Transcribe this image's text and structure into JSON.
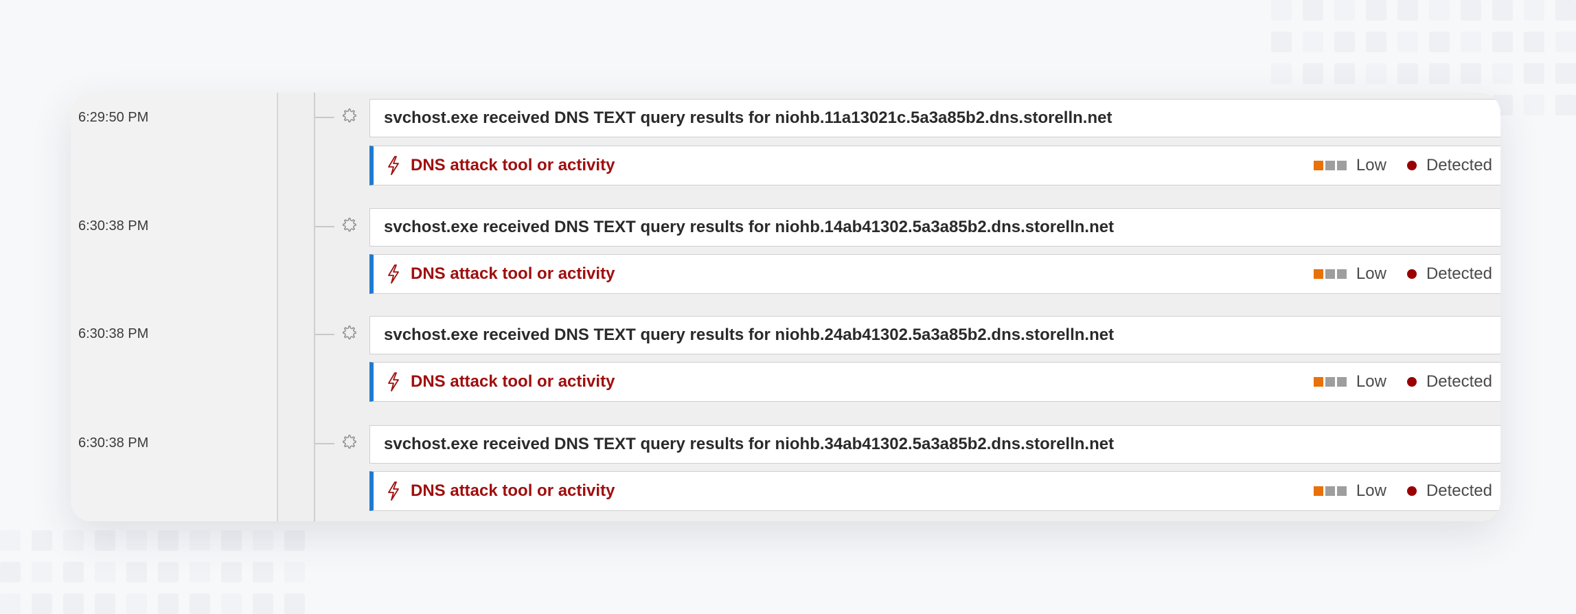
{
  "timeline": {
    "events": [
      {
        "time": "6:29:50 PM",
        "description": "svchost.exe received DNS TEXT query results for niohb.11a13021c.5a3a85b2.dns.storelln.net",
        "event_icon": "gear-icon",
        "alert": {
          "icon": "lightning-bolt-icon",
          "title": "DNS attack tool or activity",
          "severity": "Low",
          "severity_level": 1,
          "severity_max": 3,
          "status": "Detected"
        }
      },
      {
        "time": "6:30:38 PM",
        "description": "svchost.exe received DNS TEXT query results for niohb.14ab41302.5a3a85b2.dns.storelln.net",
        "event_icon": "gear-icon",
        "alert": {
          "icon": "lightning-bolt-icon",
          "title": "DNS attack tool or activity",
          "severity": "Low",
          "severity_level": 1,
          "severity_max": 3,
          "status": "Detected"
        }
      },
      {
        "time": "6:30:38 PM",
        "description": "svchost.exe received DNS TEXT query results for niohb.24ab41302.5a3a85b2.dns.storelln.net",
        "event_icon": "gear-icon",
        "alert": {
          "icon": "lightning-bolt-icon",
          "title": "DNS attack tool or activity",
          "severity": "Low",
          "severity_level": 1,
          "severity_max": 3,
          "status": "Detected"
        }
      },
      {
        "time": "6:30:38 PM",
        "description": "svchost.exe received DNS TEXT query results for niohb.34ab41302.5a3a85b2.dns.storelln.net",
        "event_icon": "gear-icon",
        "alert": {
          "icon": "lightning-bolt-icon",
          "title": "DNS attack tool or activity",
          "severity": "Low",
          "severity_level": 1,
          "severity_max": 3,
          "status": "Detected"
        }
      }
    ]
  },
  "colors": {
    "alert_title": "#a00e0e",
    "alert_accent_bar": "#1f7ad0",
    "severity_active": "#e8710a",
    "severity_inactive": "#9e9e9e",
    "status_dot": "#990000"
  }
}
